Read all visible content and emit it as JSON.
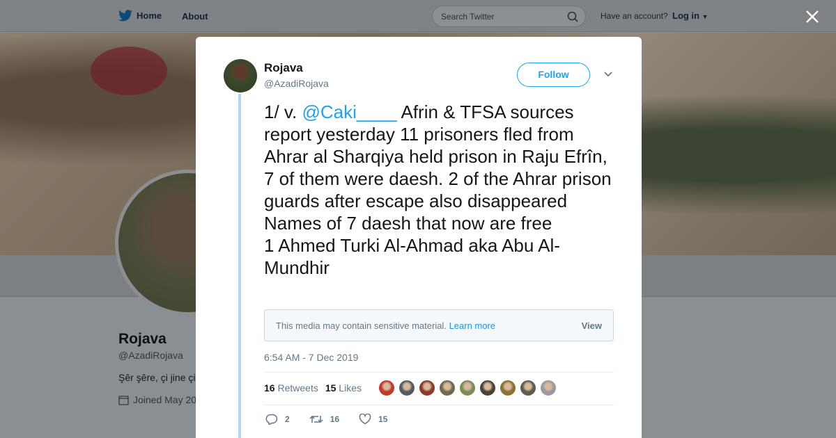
{
  "nav": {
    "home_label": "Home",
    "about_label": "About",
    "search_placeholder": "Search Twitter",
    "have_account": "Have an account?",
    "login_label": "Log in"
  },
  "background_profile": {
    "name": "Rojava",
    "handle": "@AzadiRojava",
    "bio": "Şêr şêre, çi jine çi",
    "joined": "Joined May 20"
  },
  "tweet": {
    "name": "Rojava",
    "handle": "@AzadiRojava",
    "follow_label": "Follow",
    "text_prefix": "1/ v. ",
    "mention": "@Caki____",
    "text_body": " Afrin & TFSA sources report yesterday 11 prisoners fled from Ahrar al Sharqiya held prison in Raju Efrîn, 7 of them were daesh. 2 of the Ahrar prison guards after escape also disappeared\nNames of 7 daesh that now are free\n1 Ahmed Turki Al-Ahmad aka Abu Al-Mundhir",
    "sensitive_msg": "This media may contain sensitive material.",
    "learn_more": "Learn more",
    "view_label": "View",
    "timestamp": "6:54 AM - 7 Dec 2019",
    "retweets_count": "16",
    "retweets_label": "Retweets",
    "likes_count": "15",
    "likes_label": "Likes",
    "reply_count": "2",
    "retweet_action_count": "16",
    "like_action_count": "15"
  },
  "colors": {
    "accent": "#1da1f2",
    "thread_line": "#aed8f5",
    "face_colors": [
      "#c0392b",
      "#555b60",
      "#8a3b2a",
      "#6f6a4a",
      "#7c8c57",
      "#4a4438",
      "#8a7035",
      "#5f5a52",
      "#9a9aa3"
    ]
  }
}
